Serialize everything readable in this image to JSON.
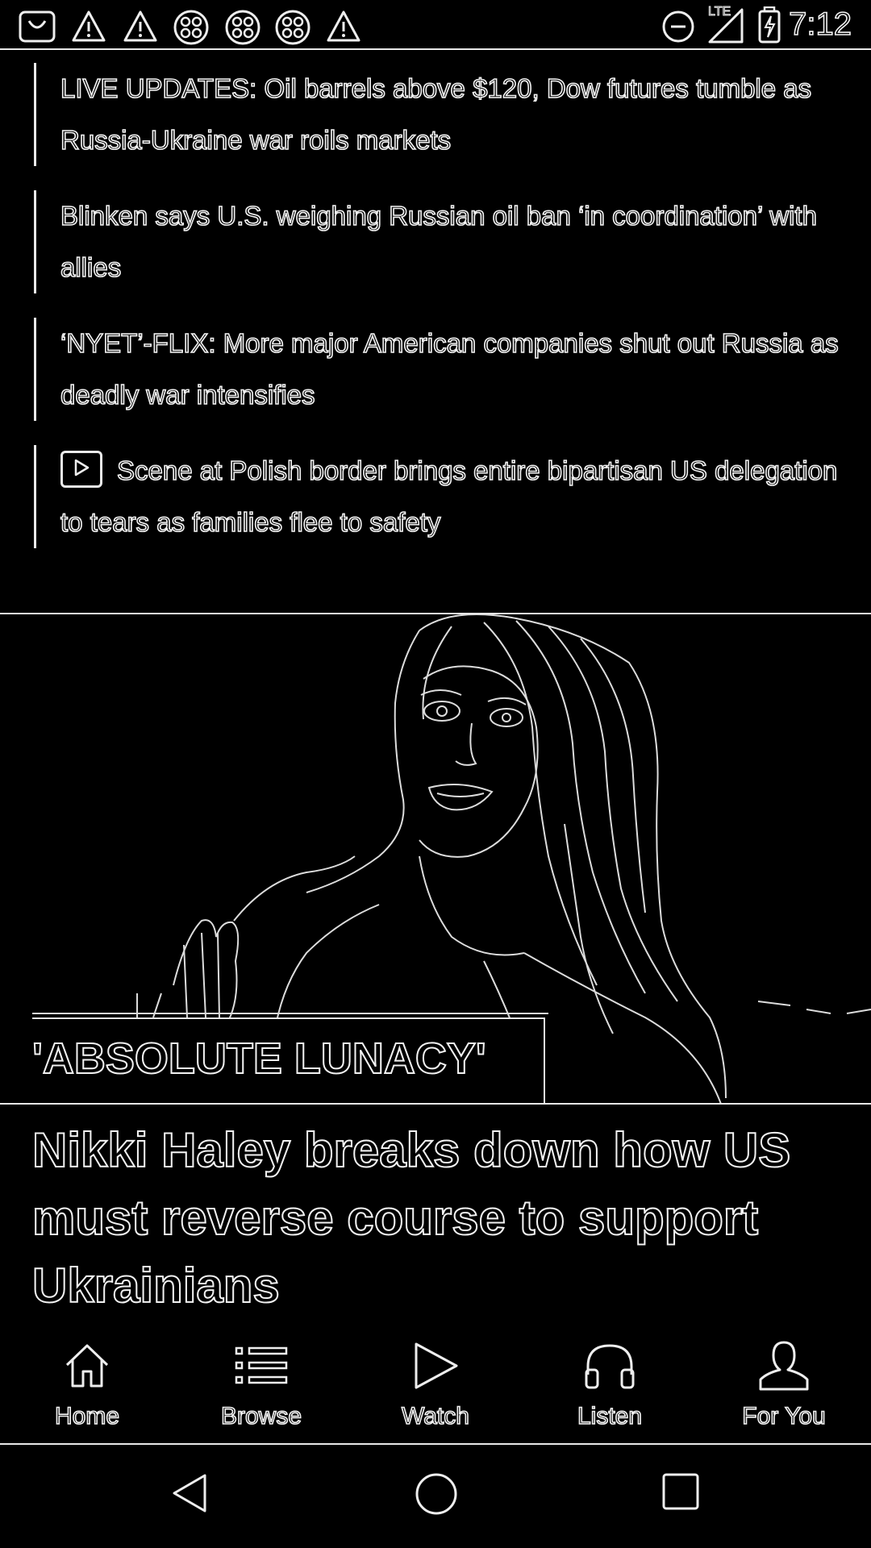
{
  "status_bar": {
    "time": "7:12",
    "left_icons": [
      "shopping-bag-icon",
      "warning-icon",
      "warning-icon",
      "app-grid-icon",
      "app-grid-icon",
      "app-grid-icon",
      "warning-icon"
    ],
    "right_icons": [
      "do-not-disturb-icon",
      "lte-signal-icon",
      "battery-charging-icon"
    ],
    "lte_label": "LTE"
  },
  "headlines": [
    {
      "text": "LIVE UPDATES: Oil barrels above $120, Dow futures tumble as Russia-Ukraine war roils markets",
      "video": false
    },
    {
      "text": "Blinken says U.S. weighing Russian oil ban ‘in coordination’ with allies",
      "video": false
    },
    {
      "text": "‘NYET’-FLIX: More major American companies shut out Russia as deadly war intensifies",
      "video": false
    },
    {
      "text": "Scene at Polish border brings entire bipartisan US delegation to tears as families flee to safety",
      "video": true
    }
  ],
  "hero": {
    "kicker": "'ABSOLUTE LUNACY'",
    "title": "Nikki Haley breaks down how US must reverse course to support Ukrainians"
  },
  "bottom_nav": {
    "items": [
      {
        "label": "Home",
        "icon": "home-icon"
      },
      {
        "label": "Browse",
        "icon": "list-icon"
      },
      {
        "label": "Watch",
        "icon": "play-icon"
      },
      {
        "label": "Listen",
        "icon": "headphones-icon"
      },
      {
        "label": "For You",
        "icon": "person-icon"
      }
    ]
  },
  "system_nav": [
    "back-icon",
    "home-circle-icon",
    "recents-icon"
  ]
}
